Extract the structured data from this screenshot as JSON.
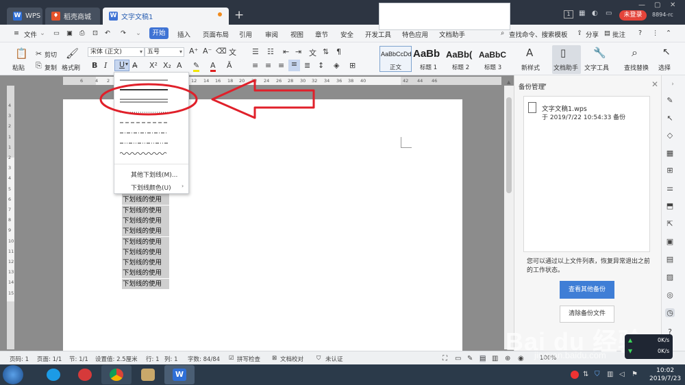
{
  "titlebar": {
    "tabs": [
      {
        "label": "WPS",
        "icon": "wps-logo-icon"
      },
      {
        "label": "稻壳商城",
        "icon": "docer-fire-icon"
      },
      {
        "label": "文字文稿1",
        "icon": "writer-doc-icon"
      }
    ],
    "badge": "1",
    "login": "未登录",
    "user_id": "8894-rc"
  },
  "menu": {
    "file": "文件",
    "start": "开始",
    "items": [
      "插入",
      "页面布局",
      "引用",
      "审阅",
      "视图",
      "章节",
      "安全",
      "开发工具",
      "特色应用",
      "文档助手"
    ],
    "search": "查找命令、搜索模板",
    "share": "分享",
    "comment": "批注"
  },
  "ribbon": {
    "paste": "粘贴",
    "cut": "剪切",
    "copy": "复制",
    "format_painter": "格式刷",
    "font_name": "宋体 (正文)",
    "font_size": "五号",
    "styles": [
      {
        "preview": "AaBbCcDd",
        "name": "正文"
      },
      {
        "preview": "AaBb",
        "name": "标题 1"
      },
      {
        "preview": "AaBb(",
        "name": "标题 2"
      },
      {
        "preview": "AaBbC",
        "name": "标题 3"
      }
    ],
    "new_style": "新样式",
    "doc_helper": "文档助手",
    "text_tools": "文字工具",
    "find_replace": "查找替换",
    "select": "选择"
  },
  "ruler": {
    "h_ticks": [
      "6",
      "4",
      "2",
      "2",
      "4",
      "6",
      "8",
      "10",
      "12",
      "14",
      "16",
      "18",
      "20",
      "22",
      "24",
      "26",
      "28",
      "30",
      "32",
      "34",
      "36",
      "38",
      "40",
      "42",
      "44",
      "46"
    ],
    "v_ticks": [
      "4",
      "3",
      "2",
      "1",
      "1",
      "2",
      "3",
      "4",
      "5",
      "6",
      "7",
      "8",
      "9",
      "10",
      "11",
      "12",
      "13",
      "14",
      "15"
    ]
  },
  "document": {
    "lines": [
      "下划线的使用",
      "下划线的使用",
      "下划线的使用",
      "下划线的使用",
      "下划线的使用",
      "下划线的使用",
      "下划线的使用",
      "下划线的使用",
      "下划线的使用",
      "下划线的使用"
    ]
  },
  "underline_menu": {
    "more": "其他下划线(M)...",
    "color": "下划线颜色(U)"
  },
  "panel": {
    "title": "备份管理",
    "file_name": "文字文稿1.wps",
    "file_date": "于 2019/7/22 10:54:33 备份",
    "description": "您可以通过以上文件列表，恢复异常退出之前的工作状态。",
    "view_button": "查看其他备份",
    "clear_button": "清除备份文件"
  },
  "statusbar": {
    "page_num": "页码: 1",
    "pages": "页面: 1/1",
    "section": "节: 1/1",
    "setting": "设置值: 2.5厘米",
    "row": "行: 1",
    "col": "列: 1",
    "word_count": "字数: 84/84",
    "spell": "拼写检查",
    "proof": "文档校对",
    "cert": "未认证",
    "zoom": "100%"
  },
  "network": {
    "up": "0K/s",
    "down": "0K/s"
  },
  "taskbar": {
    "time": "10:02",
    "date": "2019/7/23"
  },
  "watermark": {
    "text": "Bai du 经验",
    "url": "jingyan.baidu.com"
  },
  "colors": {
    "accent": "#3f73d4",
    "annotation": "#e0202a",
    "selection": "#cfcfcf"
  }
}
